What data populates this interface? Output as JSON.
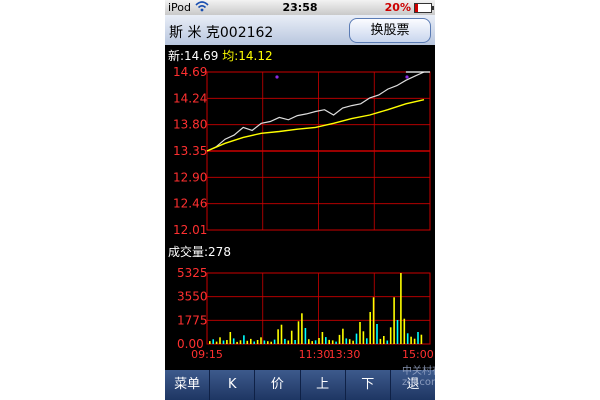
{
  "status": {
    "carrier": "iPod",
    "time": "23:58",
    "battery": "20%",
    "battery_level": 0.2
  },
  "header": {
    "title": "斯 米 克002162",
    "button": "换股票"
  },
  "quote": {
    "new_label": "新:",
    "new_value": "14.69",
    "avg_label": "均:",
    "avg_value": "14.12"
  },
  "volume_label": "成交量:278",
  "toolbar": [
    "菜单",
    "K",
    "价",
    "上",
    "下",
    "退"
  ],
  "watermark": "中关村在线 zol.com.cn",
  "colors": {
    "price": "#dddddd",
    "average": "#ffff00",
    "grid": "#cc0000",
    "axis_text": "#ff3030",
    "toolbar": "#2a4576",
    "volume_up": "#ffff00",
    "volume_down": "#00ffff"
  },
  "chart_data": [
    {
      "type": "line",
      "y_ticks": [
        "14.69",
        "14.24",
        "13.80",
        "13.35",
        "12.90",
        "12.46",
        "12.01"
      ],
      "ylim": [
        12.01,
        14.69
      ],
      "series": [
        {
          "x": [
            0,
            10,
            20,
            30,
            40,
            50,
            60,
            70,
            80,
            90,
            100,
            110,
            120,
            130,
            140,
            150,
            160,
            170,
            180,
            190,
            200,
            210,
            220,
            230,
            240
          ],
          "values": [
            13.35,
            13.42,
            13.55,
            13.62,
            13.75,
            13.7,
            13.82,
            13.85,
            13.92,
            13.88,
            13.95,
            13.98,
            14.02,
            14.05,
            13.96,
            14.08,
            14.12,
            14.15,
            14.25,
            14.3,
            14.4,
            14.46,
            14.55,
            14.62,
            14.69
          ]
        },
        {
          "x": [
            0,
            20,
            40,
            60,
            80,
            100,
            120,
            140,
            160,
            180,
            200,
            220,
            240
          ],
          "values": [
            13.35,
            13.48,
            13.58,
            13.65,
            13.68,
            13.72,
            13.75,
            13.82,
            13.9,
            13.96,
            14.05,
            14.15,
            14.22
          ]
        }
      ]
    },
    {
      "type": "bar",
      "y_ticks": [
        "5325",
        "3550",
        "1775",
        "0.00"
      ],
      "ylim": [
        0,
        5325
      ],
      "x_ticks": [
        "09:15",
        "11:30",
        "13:30",
        "15:00"
      ],
      "values": [
        220,
        350,
        180,
        500,
        260,
        300,
        900,
        420,
        160,
        280,
        650,
        240,
        380,
        190,
        300,
        500,
        260,
        210,
        170,
        330,
        1100,
        1450,
        380,
        260,
        1000,
        300,
        1700,
        2300,
        1200,
        360,
        220,
        280,
        450,
        900,
        520,
        310,
        270,
        180,
        680,
        1150,
        420,
        360,
        250,
        780,
        1650,
        950,
        430,
        2400,
        3500,
        1500,
        380,
        600,
        260,
        1250,
        3500,
        1800,
        5325,
        1900,
        800,
        550,
        400,
        900,
        700
      ]
    }
  ]
}
